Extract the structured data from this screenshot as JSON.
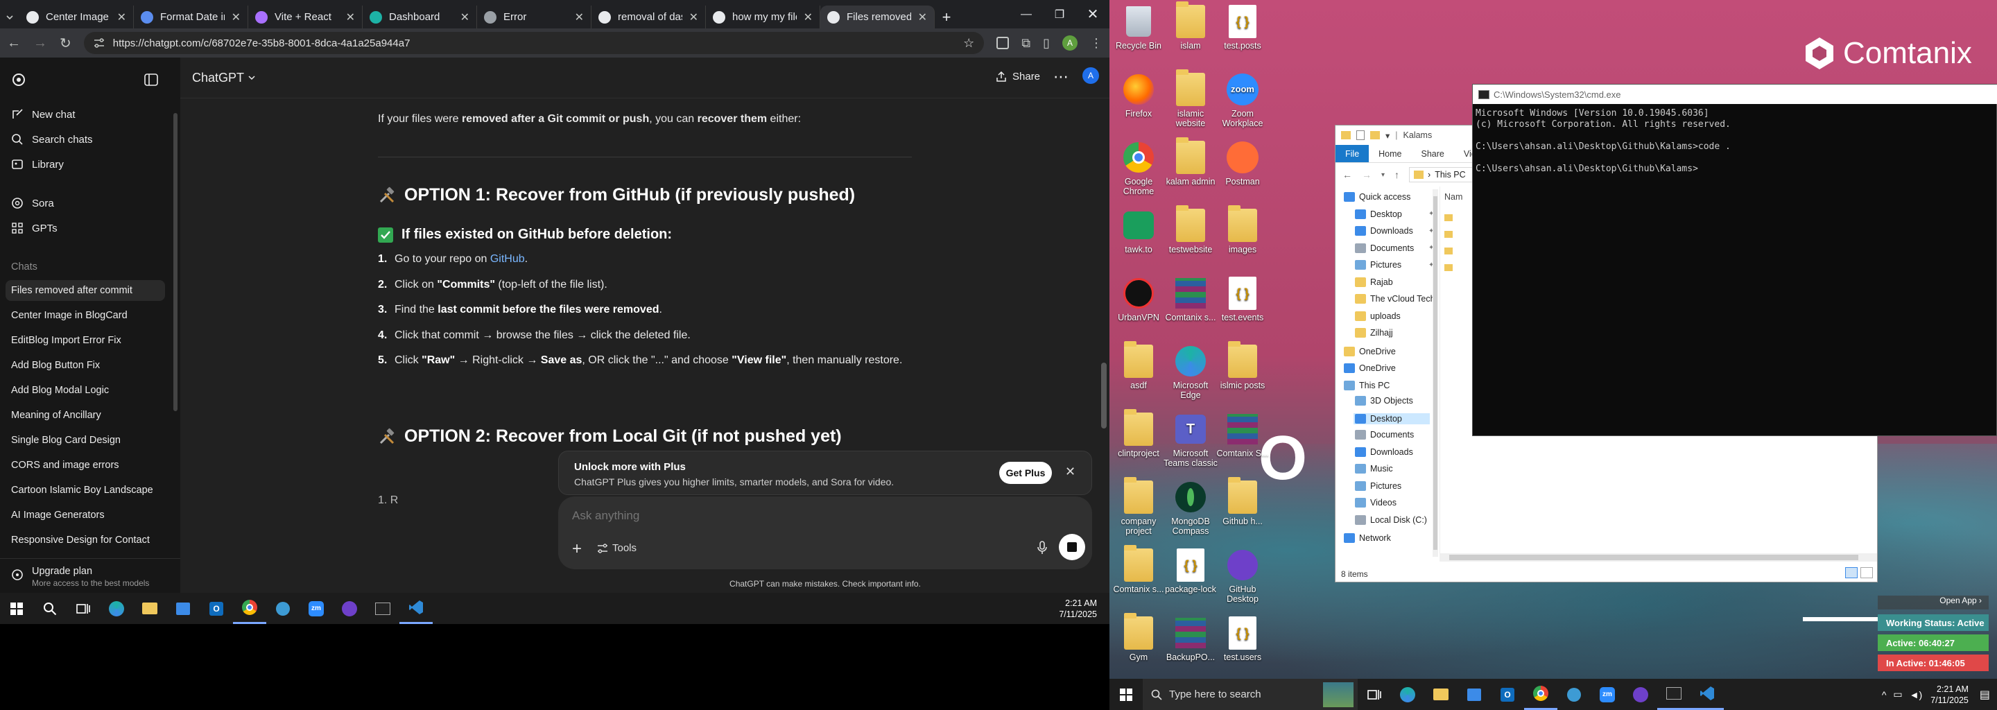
{
  "browser": {
    "tabs": [
      {
        "label": "Center Image in BlogCard",
        "color": "#e8eaed"
      },
      {
        "label": "Format Date in React",
        "color": "#5b8def"
      },
      {
        "label": "Vite + React",
        "color": "#a970ff"
      },
      {
        "label": "Dashboard",
        "color": "#1db2a6"
      },
      {
        "label": "Error",
        "color": "#9aa0a6"
      },
      {
        "label": "removal of dashboard",
        "color": "#e8eaed"
      },
      {
        "label": "how my my files are",
        "color": "#e8eaed"
      },
      {
        "label": "Files removed after commit",
        "color": "#e8eaed"
      }
    ],
    "url": "https://chatgpt.com/c/68702e7e-35b8-8001-8dca-4a1a25a944a7",
    "profile_letter": "A"
  },
  "chatgpt": {
    "model": "ChatGPT",
    "share_label": "Share",
    "avatar_letter": "A",
    "sidebar": {
      "new_chat": "New chat",
      "search": "Search chats",
      "library": "Library",
      "sora": "Sora",
      "gpts": "GPTs",
      "section": "Chats",
      "chats": [
        "Files removed after commit",
        "Center Image in BlogCard",
        "EditBlog Import Error Fix",
        "Add Blog Button Fix",
        "Add Blog Modal Logic",
        "Meaning of Ancillary",
        "Single Blog Card Design",
        "CORS and image errors",
        "Cartoon Islamic Boy Landscape",
        "AI Image Generators",
        "Responsive Design for Contact"
      ],
      "upgrade_title": "Upgrade plan",
      "upgrade_sub": "More access to the best models"
    },
    "content": {
      "intro_pre": "If your files were ",
      "intro_b1": "removed after a Git commit or push",
      "intro_mid": ", you can ",
      "intro_b2": "recover them",
      "intro_post": " either:",
      "option1": "OPTION 1: Recover from GitHub (if previously pushed)",
      "sub1": "If files existed on GitHub before deletion:",
      "steps": [
        {
          "n": "1.",
          "a": "Go to your repo on ",
          "link": "GitHub",
          "b": "."
        },
        {
          "n": "2.",
          "a": "Click on ",
          "bold": "\"Commits\"",
          "b": " (top-left of the file list)."
        },
        {
          "n": "3.",
          "a": "Find the ",
          "bold": "last commit before the files were removed",
          "b": "."
        },
        {
          "n": "4.",
          "a": "Click that commit → browse the files → click the deleted file.",
          "bold": "",
          "b": ""
        },
        {
          "n": "5.",
          "a": "Click ",
          "bold": "\"Raw\"",
          "b": " → Right-click → ",
          "bold2": "Save as",
          "c": ", OR click the \"...\" and choose ",
          "bold3": "\"View file\"",
          "d": ", then manually restore."
        }
      ],
      "option2": "OPTION 2: Recover from Local Git (if not pushed yet)",
      "partial": "1.  R"
    },
    "upsell": {
      "title": "Unlock more with Plus",
      "body": "ChatGPT Plus gives you higher limits, smarter models, and Sora for video.",
      "button": "Get Plus"
    },
    "composer": {
      "placeholder": "Ask anything",
      "tools": "Tools"
    },
    "disclaimer": "ChatGPT can make mistakes. Check important info."
  },
  "taskbar_left": {
    "time": "2:21 AM",
    "date": "7/11/2025"
  },
  "desktop": {
    "brand": "Comtanix",
    "overlay_text": "O P",
    "icons": [
      {
        "label": "Recycle Bin",
        "kind": "bin"
      },
      {
        "label": "islam",
        "kind": "folder"
      },
      {
        "label": "test.posts",
        "kind": "json"
      },
      {
        "label": "Firefox",
        "kind": "firefox"
      },
      {
        "label": "islamic website",
        "kind": "folder"
      },
      {
        "label": "Zoom Workplace",
        "kind": "zoom"
      },
      {
        "label": "Google Chrome",
        "kind": "chrome"
      },
      {
        "label": "kalam admin",
        "kind": "folder"
      },
      {
        "label": "Postman",
        "kind": "postman"
      },
      {
        "label": "tawk.to",
        "kind": "tawk"
      },
      {
        "label": "testwebsite",
        "kind": "folder"
      },
      {
        "label": "images",
        "kind": "folder"
      },
      {
        "label": "UrbanVPN",
        "kind": "vpn"
      },
      {
        "label": "Comtanix s...",
        "kind": "rar"
      },
      {
        "label": "test.events",
        "kind": "json"
      },
      {
        "label": "asdf",
        "kind": "folder"
      },
      {
        "label": "Microsoft Edge",
        "kind": "edge"
      },
      {
        "label": "islmic posts",
        "kind": "folder"
      },
      {
        "label": "clintproject",
        "kind": "folder"
      },
      {
        "label": "Microsoft Teams classic",
        "kind": "teams"
      },
      {
        "label": "Comtanix S...",
        "kind": "rar"
      },
      {
        "label": "company project",
        "kind": "folder"
      },
      {
        "label": "MongoDB Compass",
        "kind": "mongo"
      },
      {
        "label": "Github h...",
        "kind": "folder"
      },
      {
        "label": "Comtanix s...",
        "kind": "folder"
      },
      {
        "label": "package-lock",
        "kind": "json"
      },
      {
        "label": "GitHub Desktop",
        "kind": "github"
      },
      {
        "label": "Gym",
        "kind": "folder"
      },
      {
        "label": "BackupPO...",
        "kind": "rar"
      },
      {
        "label": "test.users",
        "kind": "json"
      }
    ]
  },
  "cmd": {
    "title": "C:\\Windows\\System32\\cmd.exe",
    "lines": [
      "Microsoft Windows [Version 10.0.19045.6036]",
      "(c) Microsoft Corporation. All rights reserved.",
      "",
      "C:\\Users\\ahsan.ali\\Desktop\\Github\\Kalams>code .",
      "",
      "C:\\Users\\ahsan.ali\\Desktop\\Github\\Kalams>"
    ]
  },
  "explorer": {
    "title": "Kalams",
    "ribbon": [
      "File",
      "Home",
      "Share",
      "View"
    ],
    "path": "This PC",
    "col_header": "Nam",
    "nav": [
      {
        "label": "Quick access",
        "color": "#3c8be8",
        "indent": 0
      },
      {
        "label": "Desktop",
        "color": "#3c8be8",
        "indent": 1,
        "pin": true
      },
      {
        "label": "Downloads",
        "color": "#3c8be8",
        "indent": 1,
        "pin": true
      },
      {
        "label": "Documents",
        "color": "#9aa6b5",
        "indent": 1,
        "pin": true
      },
      {
        "label": "Pictures",
        "color": "#6fa8dc",
        "indent": 1,
        "pin": true
      },
      {
        "label": "Rajab",
        "color": "#f0c85c",
        "indent": 1
      },
      {
        "label": "The vCloud Tech",
        "color": "#f0c85c",
        "indent": 1
      },
      {
        "label": "uploads",
        "color": "#f0c85c",
        "indent": 1
      },
      {
        "label": "Zilhajj",
        "color": "#f0c85c",
        "indent": 1
      },
      {
        "label": "OneDrive",
        "color": "#f0c85c",
        "indent": 0
      },
      {
        "label": "OneDrive",
        "color": "#3c8be8",
        "indent": 0
      },
      {
        "label": "This PC",
        "color": "#6fa8dc",
        "indent": 0
      },
      {
        "label": "3D Objects",
        "color": "#6fa8dc",
        "indent": 1
      },
      {
        "label": "Desktop",
        "color": "#3c8be8",
        "indent": 1,
        "sel": true
      },
      {
        "label": "Documents",
        "color": "#9aa6b5",
        "indent": 1
      },
      {
        "label": "Downloads",
        "color": "#3c8be8",
        "indent": 1
      },
      {
        "label": "Music",
        "color": "#6fa8dc",
        "indent": 1
      },
      {
        "label": "Pictures",
        "color": "#6fa8dc",
        "indent": 1
      },
      {
        "label": "Videos",
        "color": "#6fa8dc",
        "indent": 1
      },
      {
        "label": "Local Disk (C:)",
        "color": "#9aa6b5",
        "indent": 1
      },
      {
        "label": "Network",
        "color": "#3c8be8",
        "indent": 0
      }
    ],
    "status": "8 items"
  },
  "work_status": {
    "open_app": "Open App ›",
    "status": "Working Status: Active",
    "active": "Active: 06:40:27",
    "inactive": "In Active: 01:46:05"
  },
  "taskbar_right": {
    "search_placeholder": "Type here to search",
    "time": "2:21 AM",
    "date": "7/11/2025"
  }
}
